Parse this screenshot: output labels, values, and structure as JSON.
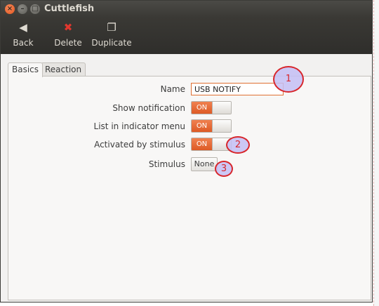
{
  "window": {
    "title": "Cuttlefish",
    "close_glyph": "×",
    "minimize_glyph": "–",
    "maximize_glyph": "□"
  },
  "toolbar": {
    "back": {
      "label": "Back",
      "icon": "back-arrow-icon",
      "glyph": "◀"
    },
    "delete": {
      "label": "Delete",
      "icon": "delete-x-icon",
      "glyph": "✖",
      "color": "#e2372e"
    },
    "duplicate": {
      "label": "Duplicate",
      "icon": "duplicate-icon",
      "glyph": "❐"
    }
  },
  "tabs": [
    {
      "label": "Basics",
      "active": true
    },
    {
      "label": "Reaction",
      "active": false
    }
  ],
  "form": {
    "name_label": "Name",
    "name_value": "USB NOTIFY",
    "show_notification_label": "Show notification",
    "show_notification_state": "ON",
    "list_indicator_label": "List in indicator menu",
    "list_indicator_state": "ON",
    "activated_label": "Activated by stimulus",
    "activated_state": "ON",
    "stimulus_label": "Stimulus",
    "stimulus_value": "None"
  },
  "annotations": {
    "marker1": "1",
    "marker2": "2",
    "marker3": "3",
    "marker_color": "#d8262b"
  },
  "colors": {
    "accent": "#dd5a25",
    "titlebar": "#3c3b37"
  }
}
